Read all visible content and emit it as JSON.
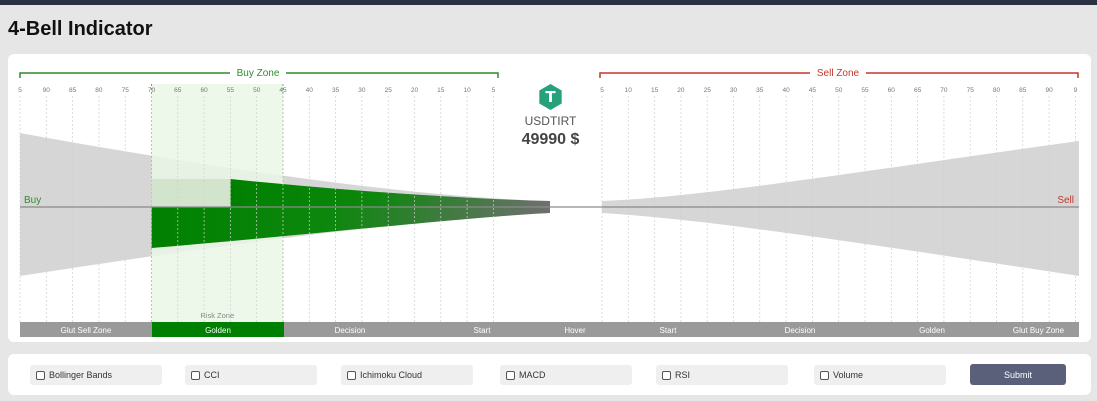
{
  "title": "4-Bell Indicator",
  "zones": {
    "buy_label": "Buy Zone",
    "sell_label": "Sell Zone",
    "buy_color": "#2f8c2f",
    "sell_color": "#c0392b"
  },
  "scale": {
    "left_ticks": [
      "5",
      "90",
      "85",
      "80",
      "75",
      "70",
      "65",
      "60",
      "55",
      "50",
      "45",
      "40",
      "35",
      "30",
      "25",
      "20",
      "15",
      "10",
      "5"
    ],
    "right_ticks": [
      "5",
      "10",
      "15",
      "20",
      "25",
      "30",
      "35",
      "40",
      "45",
      "50",
      "55",
      "60",
      "65",
      "70",
      "75",
      "80",
      "85",
      "90",
      "9"
    ]
  },
  "side_labels": {
    "buy": "Buy",
    "sell": "Sell"
  },
  "risk_zone_label": "Risk Zone",
  "hover": {
    "icon": "tether-icon",
    "icon_glyph": "T",
    "symbol": "USDTIRT",
    "price": "49990 $"
  },
  "indicator_level": {
    "upper_start": 55,
    "lower_start": 70,
    "unit": "percent"
  },
  "bottom_bar": {
    "segments": [
      "Glut Sell Zone",
      "Golden",
      "Decision",
      "Start",
      "Hover",
      "Start",
      "Decision",
      "Golden",
      "Glut Buy Zone"
    ]
  },
  "toolbar": {
    "indicators": [
      "Bollinger Bands",
      "CCI",
      "Ichimoku Cloud",
      "MACD",
      "RSI",
      "Volume"
    ],
    "submit_label": "Submit"
  },
  "colors": {
    "green": "#008000",
    "grey_bell": "#d6d6d6",
    "bottom_bar": "#9a9a9a",
    "submit": "#5a6079"
  }
}
